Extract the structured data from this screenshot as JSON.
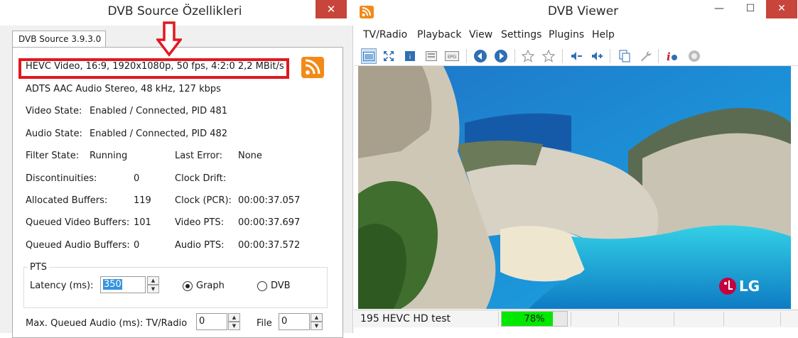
{
  "source_window": {
    "title": "DVB Source Özellikleri",
    "close_label": "✕",
    "tab_label": "DVB Source 3.9.3.0",
    "video_info": "HEVC Video, 16:9, 1920x1080p, 50 fps, 4:2:0   2,2 MBit/s",
    "audio_info": "ADTS AAC Audio Stereo, 48 kHz, 127 kbps",
    "video_state_label": "Video State:",
    "video_state_value": "Enabled / Connected, PID 481",
    "audio_state_label": "Audio State:",
    "audio_state_value": "Enabled / Connected, PID 482",
    "filter_state_label": "Filter State:",
    "filter_state_value": "Running",
    "last_error_label": "Last Error:",
    "last_error_value": "None",
    "discontinuities_label": "Discontinuities:",
    "discontinuities_value": "0",
    "clock_drift_label": "Clock Drift:",
    "allocated_buffers_label": "Allocated Buffers:",
    "allocated_buffers_value": "119",
    "clock_pcr_label": "Clock (PCR):",
    "clock_pcr_value": "00:00:37.057",
    "queued_video_label": "Queued Video Buffers:",
    "queued_video_value": "101",
    "video_pts_label": "Video PTS:",
    "video_pts_value": "00:00:37.697",
    "queued_audio_label": "Queued Audio Buffers:",
    "queued_audio_value": "0",
    "audio_pts_label": "Audio PTS:",
    "audio_pts_value": "00:00:37.572",
    "pts_group_label": "PTS",
    "latency_label": "Latency (ms):",
    "latency_value": "350",
    "graph_label": "Graph",
    "dvb_label": "DVB",
    "max_queued_label": "Max. Queued Audio (ms): TV/Radio",
    "tv_radio_value": "0",
    "file_label": "File",
    "file_value": "0"
  },
  "viewer_window": {
    "title": "DVB Viewer",
    "minimize_label": "—",
    "maximize_label": "☐",
    "close_label": "✕",
    "menu": [
      "TV/Radio",
      "Playback",
      "View",
      "Settings",
      "Plugins",
      "Help"
    ],
    "brand_logo": "LG",
    "status_channel": "195 HEVC HD test",
    "signal_percent": 78,
    "signal_label": "78%"
  },
  "colors": {
    "highlight_border": "#e01920",
    "progress_fill": "#00e800",
    "close_button": "#c7453a",
    "rss_orange": "#f28a18"
  }
}
